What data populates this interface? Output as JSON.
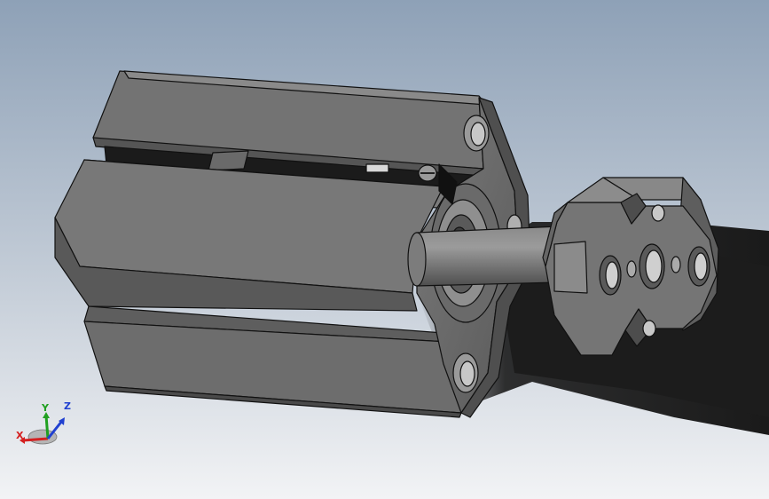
{
  "viewport": {
    "background_top": "#8ea1b7",
    "background_bottom": "#f2f3f5",
    "shadow_color": "#1b1b1b"
  },
  "model": {
    "body_color": "#6c6c6c",
    "body_dark": "#3e3e3e",
    "body_light": "#8a8a8a",
    "edge_color": "#111111"
  },
  "triad": {
    "x_label": "X",
    "y_label": "Y",
    "z_label": "Z",
    "x_color": "#d42020",
    "y_color": "#20a020",
    "z_color": "#2040d0"
  }
}
